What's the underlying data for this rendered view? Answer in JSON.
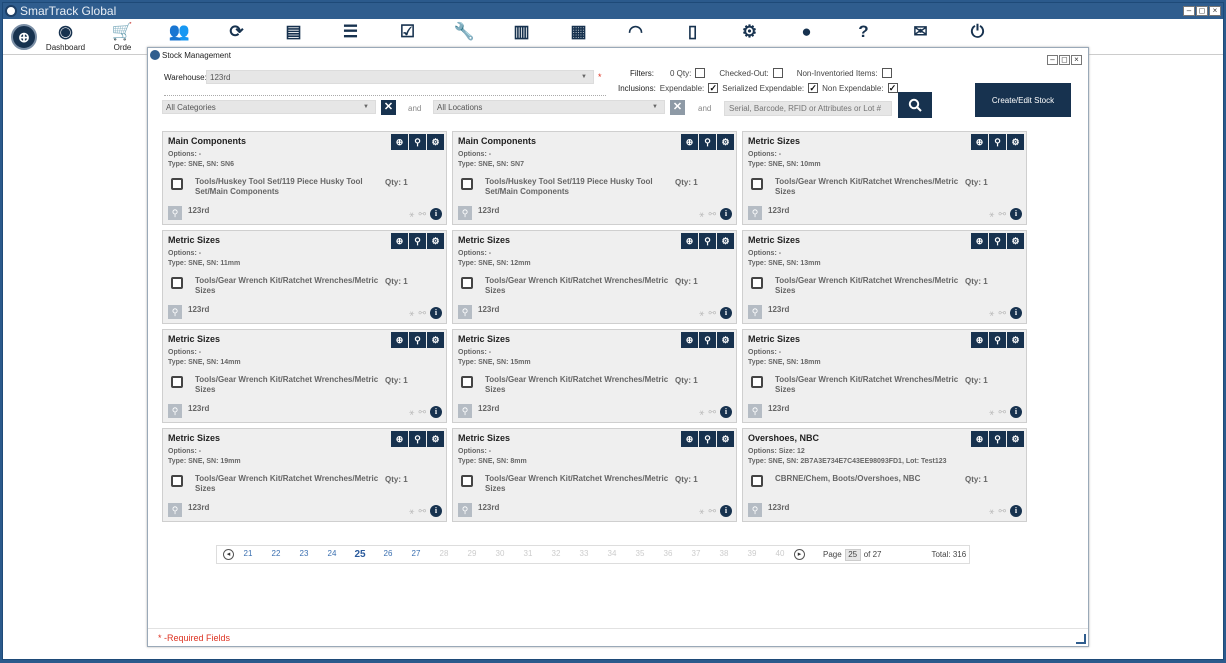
{
  "app": {
    "title": "SmarTrack Global",
    "win_min": "–",
    "win_max": "◻",
    "win_close": "×"
  },
  "toolbar": [
    {
      "icon": "◉",
      "name": "dashboard-icon",
      "label": "Dashboard"
    },
    {
      "icon": "🛒",
      "name": "cart-icon",
      "label": "Orde"
    },
    {
      "icon": "👥",
      "name": "users-icon",
      "label": ""
    },
    {
      "icon": "⟳",
      "name": "refresh-icon",
      "label": ""
    },
    {
      "icon": "▤",
      "name": "documents-icon",
      "label": ""
    },
    {
      "icon": "☰",
      "name": "list-icon",
      "label": ""
    },
    {
      "icon": "☑",
      "name": "checklist-icon",
      "label": ""
    },
    {
      "icon": "🔧",
      "name": "wrench-icon",
      "label": ""
    },
    {
      "icon": "▥",
      "name": "chart-icon",
      "label": ""
    },
    {
      "icon": "▦",
      "name": "calendar-icon",
      "label": ""
    },
    {
      "icon": "◠",
      "name": "rss-icon",
      "label": ""
    },
    {
      "icon": "▯",
      "name": "mobile-icon",
      "label": ""
    },
    {
      "icon": "⚙",
      "name": "settings-icon",
      "label": ""
    },
    {
      "icon": "●",
      "name": "user-icon",
      "label": ""
    },
    {
      "icon": "?",
      "name": "help-icon",
      "label": ""
    },
    {
      "icon": "✉",
      "name": "mail-icon",
      "label": ""
    },
    {
      "icon": "⏻",
      "name": "power-icon",
      "label": ""
    }
  ],
  "dialog": {
    "title": "Stock Management",
    "warehouse_label": "Warehouse:",
    "warehouse_value": "123rd",
    "required_star": "*",
    "filters_label": "Filters:",
    "filter_zero_qty": "0 Qty:",
    "filter_checked_out": "Checked-Out:",
    "filter_non_inventoried": "Non-Inventoried Items:",
    "inclusions_label": "Inclusions:",
    "inc_expendable": "Expendable:",
    "inc_serialized": "Serialized Expendable:",
    "inc_non_expendable": "Non Expendable:",
    "category_value": "All Categories",
    "location_value": "All Locations",
    "and_text": "and",
    "search_placeholder": "Serial, Barcode, RFID or Attributes or Lot #",
    "create_label": "Create/Edit Stock",
    "required_footer": "* -Required Fields"
  },
  "cards": [
    {
      "title": "Main Components",
      "options": "Options: -",
      "type": "Type: SNE, SN: SN6",
      "item": "Tools/Huskey Tool Set/119 Piece Husky Tool Set/Main Components",
      "qty": "Qty: 1",
      "location": "123rd"
    },
    {
      "title": "Main Components",
      "options": "Options: -",
      "type": "Type: SNE, SN: SN7",
      "item": "Tools/Huskey Tool Set/119 Piece Husky Tool Set/Main Components",
      "qty": "Qty: 1",
      "location": "123rd"
    },
    {
      "title": "Metric Sizes",
      "options": "Options: -",
      "type": "Type: SNE, SN: 10mm",
      "item": "Tools/Gear Wrench Kit/Ratchet Wrenches/Metric Sizes",
      "qty": "Qty: 1",
      "location": "123rd"
    },
    {
      "title": "Metric Sizes",
      "options": "Options: -",
      "type": "Type: SNE, SN: 11mm",
      "item": "Tools/Gear Wrench Kit/Ratchet Wrenches/Metric Sizes",
      "qty": "Qty: 1",
      "location": "123rd"
    },
    {
      "title": "Metric Sizes",
      "options": "Options: -",
      "type": "Type: SNE, SN: 12mm",
      "item": "Tools/Gear Wrench Kit/Ratchet Wrenches/Metric Sizes",
      "qty": "Qty: 1",
      "location": "123rd"
    },
    {
      "title": "Metric Sizes",
      "options": "Options: -",
      "type": "Type: SNE, SN: 13mm",
      "item": "Tools/Gear Wrench Kit/Ratchet Wrenches/Metric Sizes",
      "qty": "Qty: 1",
      "location": "123rd"
    },
    {
      "title": "Metric Sizes",
      "options": "Options: -",
      "type": "Type: SNE, SN: 14mm",
      "item": "Tools/Gear Wrench Kit/Ratchet Wrenches/Metric Sizes",
      "qty": "Qty: 1",
      "location": "123rd"
    },
    {
      "title": "Metric Sizes",
      "options": "Options: -",
      "type": "Type: SNE, SN: 15mm",
      "item": "Tools/Gear Wrench Kit/Ratchet Wrenches/Metric Sizes",
      "qty": "Qty: 1",
      "location": "123rd"
    },
    {
      "title": "Metric Sizes",
      "options": "Options: -",
      "type": "Type: SNE, SN: 18mm",
      "item": "Tools/Gear Wrench Kit/Ratchet Wrenches/Metric Sizes",
      "qty": "Qty: 1",
      "location": "123rd"
    },
    {
      "title": "Metric Sizes",
      "options": "Options: -",
      "type": "Type: SNE, SN: 19mm",
      "item": "Tools/Gear Wrench Kit/Ratchet Wrenches/Metric Sizes",
      "qty": "Qty: 1",
      "location": "123rd"
    },
    {
      "title": "Metric Sizes",
      "options": "Options: -",
      "type": "Type: SNE, SN: 8mm",
      "item": "Tools/Gear Wrench Kit/Ratchet Wrenches/Metric Sizes",
      "qty": "Qty: 1",
      "location": "123rd"
    },
    {
      "title": "Overshoes, NBC",
      "options": "Options: Size: 12",
      "type": "Type: SNE, SN: 2B7A3E734E7C43EE98093FD1, Lot: Test123",
      "item": "CBRNE/Chem, Boots/Overshoes, NBC",
      "qty": "Qty: 1",
      "location": "123rd"
    }
  ],
  "pager": {
    "prev": "◂",
    "next": "▸",
    "pages": [
      {
        "n": "21",
        "state": "link"
      },
      {
        "n": "22",
        "state": "link"
      },
      {
        "n": "23",
        "state": "link"
      },
      {
        "n": "24",
        "state": "link"
      },
      {
        "n": "25",
        "state": "current"
      },
      {
        "n": "26",
        "state": "link"
      },
      {
        "n": "27",
        "state": "link"
      },
      {
        "n": "28",
        "state": "disabled"
      },
      {
        "n": "29",
        "state": "disabled"
      },
      {
        "n": "30",
        "state": "disabled"
      },
      {
        "n": "31",
        "state": "disabled"
      },
      {
        "n": "32",
        "state": "disabled"
      },
      {
        "n": "33",
        "state": "disabled"
      },
      {
        "n": "34",
        "state": "disabled"
      },
      {
        "n": "35",
        "state": "disabled"
      },
      {
        "n": "36",
        "state": "disabled"
      },
      {
        "n": "37",
        "state": "disabled"
      },
      {
        "n": "38",
        "state": "disabled"
      },
      {
        "n": "39",
        "state": "disabled"
      },
      {
        "n": "40",
        "state": "disabled"
      }
    ],
    "page_label": "Page",
    "page_value": "25",
    "of_label": "of 27",
    "total": "Total: 316"
  },
  "colors": {
    "accent": "#17324f",
    "title_bar": "#2f5d8e",
    "required": "#dd3322"
  }
}
